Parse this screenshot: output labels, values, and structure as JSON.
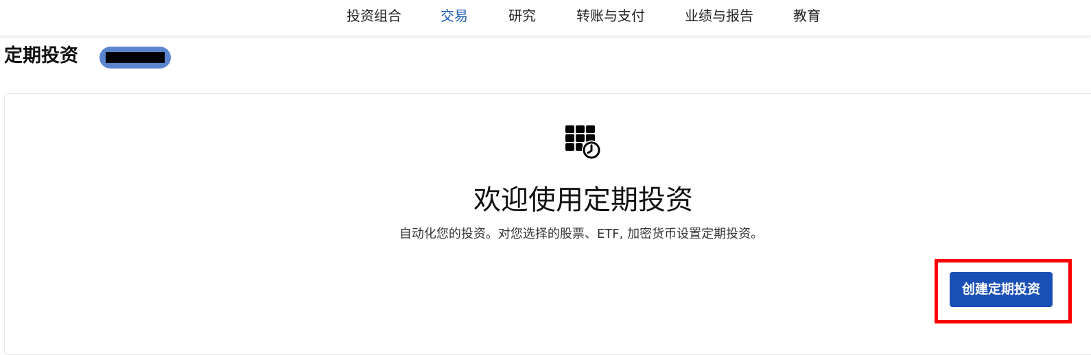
{
  "nav": {
    "items": [
      {
        "label": "投资组合",
        "active": false
      },
      {
        "label": "交易",
        "active": true
      },
      {
        "label": "研究",
        "active": false
      },
      {
        "label": "转账与支付",
        "active": false
      },
      {
        "label": "业绩与报告",
        "active": false
      },
      {
        "label": "教育",
        "active": false
      }
    ],
    "active_color": "#1a5fb4"
  },
  "page": {
    "title": "定期投资",
    "account_badge_color": "#5b86cf"
  },
  "empty_state": {
    "icon": "calendar-grid-clock-icon",
    "title": "欢迎使用定期投资",
    "subtitle": "自动化您的投资。对您选择的股票、ETF, 加密货币设置定期投资。",
    "create_button_label": "创建定期投资",
    "button_color": "#1a4fb5",
    "highlight_color": "#ff0000"
  }
}
